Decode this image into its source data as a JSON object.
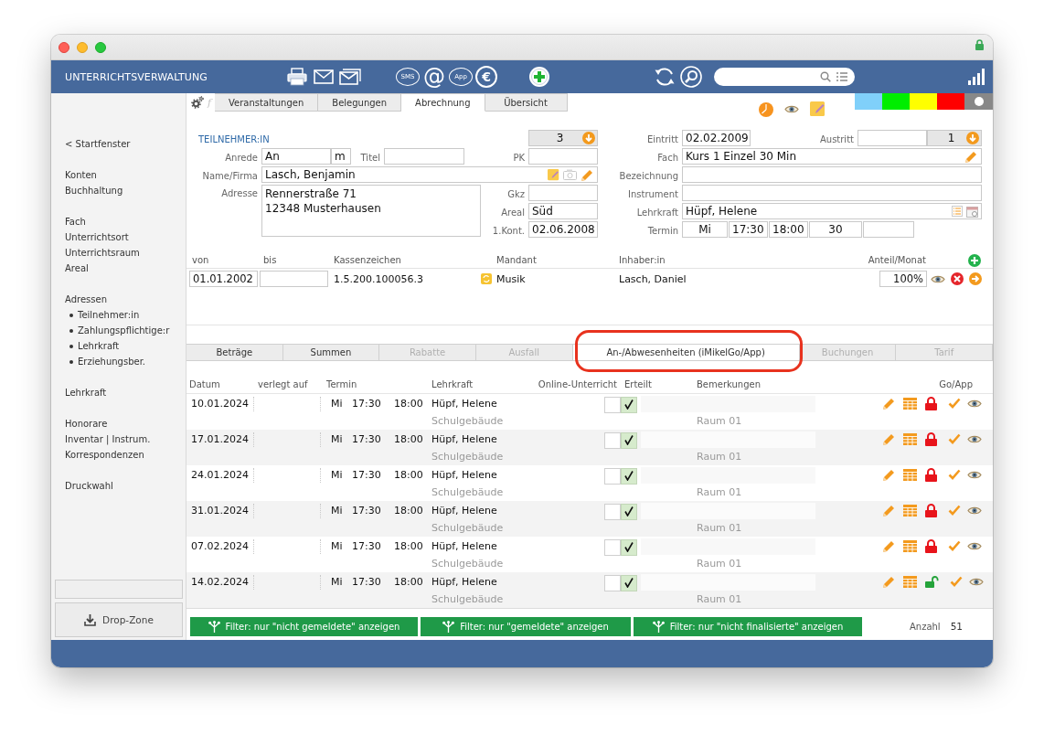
{
  "toolbar": {
    "title": "UNTERRICHTSVERWALTUNG",
    "button_groups": [
      [
        {
          "kind": "printer"
        },
        {
          "kind": "mail"
        },
        {
          "kind": "mail-stack"
        }
      ],
      [
        {
          "kind": "bubble",
          "text": "SMS"
        },
        {
          "kind": "glyph",
          "text": "@"
        },
        {
          "kind": "bubble",
          "text": "App"
        },
        {
          "kind": "ring",
          "text": "€"
        }
      ],
      [
        {
          "kind": "add"
        }
      ],
      [
        {
          "kind": "refresh"
        },
        {
          "kind": "search"
        }
      ]
    ]
  },
  "tab_tools": {
    "function_key": "f"
  },
  "tabs": [
    {
      "label": "Veranstaltungen",
      "selected": false
    },
    {
      "label": "Belegungen",
      "selected": false
    },
    {
      "label": "Abrechnung",
      "selected": true
    },
    {
      "label": "Übersicht",
      "selected": false
    }
  ],
  "color_swatches": [
    {
      "kind": "swatch",
      "color": "#80d0fa"
    },
    {
      "kind": "swatch",
      "color": "#00ee00"
    },
    {
      "kind": "swatch",
      "color": "#ffff00"
    },
    {
      "kind": "swatch",
      "color": "#ff0000"
    },
    {
      "kind": "dot",
      "color": "#888888"
    }
  ],
  "sidebar": {
    "groups": [
      [
        {
          "label": "< Startfenster"
        }
      ],
      [
        {
          "label": "Konten"
        },
        {
          "label": "Buchhaltung"
        }
      ],
      [
        {
          "label": "Fach"
        },
        {
          "label": "Unterrichtsort"
        },
        {
          "label": "Unterrichtsraum"
        },
        {
          "label": "Areal"
        }
      ],
      [
        {
          "label": "Adressen",
          "children": [
            {
              "label": "Teilnehmer:in"
            },
            {
              "label": "Zahlungspflichtige:r"
            },
            {
              "label": "Lehrkraft"
            },
            {
              "label": "Erziehungsber."
            }
          ]
        }
      ],
      [
        {
          "label": "Lehrkraft"
        }
      ],
      [
        {
          "label": "Honorare"
        },
        {
          "label": "Inventar | Instrum."
        },
        {
          "label": "Korrespondenzen"
        }
      ],
      [
        {
          "label": "Druckwahl"
        }
      ]
    ],
    "drop_zone": "Drop-Zone"
  },
  "participant": {
    "heading": "TEILNEHMER:IN",
    "counter": "3",
    "salutation": {
      "label": "Anrede",
      "value": "An",
      "gender": "m"
    },
    "title": {
      "label": "Titel"
    },
    "pk": {
      "label": "PK"
    },
    "name": {
      "label": "Name/Firma",
      "value": "Lasch, Benjamin"
    },
    "address": {
      "label": "Adresse",
      "lines": [
        "Rennerstraße 71",
        "12348 Musterhausen"
      ]
    },
    "gkz": {
      "label": "Gkz"
    },
    "area": {
      "label": "Areal",
      "value": "Süd"
    },
    "first_contact": {
      "label": "1.Kont.",
      "value": "02.06.2008"
    }
  },
  "course": {
    "entry": {
      "label": "Eintritt",
      "value": "02.02.2009"
    },
    "exit": {
      "label": "Austritt",
      "counter": "1"
    },
    "subject": {
      "label": "Fach",
      "value": "Kurs 1 Einzel 30 Min"
    },
    "designation": {
      "label": "Bezeichnung"
    },
    "instrument": {
      "label": "Instrument"
    },
    "teacher": {
      "label": "Lehrkraft",
      "value": "Hüpf, Helene"
    },
    "schedule": {
      "label": "Termin",
      "day": "Mi",
      "start": "17:30",
      "end": "18:00",
      "minutes": "30"
    }
  },
  "payers": {
    "columns": [
      "von",
      "bis",
      "Kassenzeichen",
      "Mandant",
      "Inhaber:in",
      "Anteil/Monat"
    ],
    "rows": [
      {
        "from": "01.01.2002",
        "reference": "1.5.200.100056.3",
        "client": "Musik",
        "holder": "Lasch, Daniel",
        "share": "100%"
      }
    ]
  },
  "detail_tabs": [
    {
      "label": "Beträge",
      "selected": false,
      "disabled": false,
      "highlighted": false
    },
    {
      "label": "Summen",
      "selected": false,
      "disabled": false,
      "highlighted": false
    },
    {
      "label": "Rabatte",
      "selected": false,
      "disabled": true,
      "highlighted": false
    },
    {
      "label": "Ausfall",
      "selected": false,
      "disabled": true,
      "highlighted": false
    },
    {
      "label": "An-/Abwesenheiten (iMikelGo/App)",
      "selected": true,
      "disabled": false,
      "highlighted": true
    },
    {
      "label": "Buchungen",
      "selected": false,
      "disabled": true,
      "highlighted": false
    },
    {
      "label": "Tarif",
      "selected": false,
      "disabled": true,
      "highlighted": false
    }
  ],
  "attendance": {
    "columns": [
      "Datum",
      "verlegt auf",
      "Termin",
      "Lehrkraft",
      "Online-Unterricht",
      "Erteilt",
      "Bemerkungen",
      "Go/App"
    ],
    "rows": [
      {
        "date": "10.01.2024",
        "day": "Mi",
        "start": "17:30",
        "end": "18:00",
        "teacher": "Hüpf, Helene",
        "location": "Schulgebäude",
        "room": "Raum 01",
        "online": false,
        "given": true,
        "locked": true
      },
      {
        "date": "17.01.2024",
        "day": "Mi",
        "start": "17:30",
        "end": "18:00",
        "teacher": "Hüpf, Helene",
        "location": "Schulgebäude",
        "room": "Raum 01",
        "online": false,
        "given": true,
        "locked": true
      },
      {
        "date": "24.01.2024",
        "day": "Mi",
        "start": "17:30",
        "end": "18:00",
        "teacher": "Hüpf, Helene",
        "location": "Schulgebäude",
        "room": "Raum 01",
        "online": false,
        "given": true,
        "locked": true
      },
      {
        "date": "31.01.2024",
        "day": "Mi",
        "start": "17:30",
        "end": "18:00",
        "teacher": "Hüpf, Helene",
        "location": "Schulgebäude",
        "room": "Raum 01",
        "online": false,
        "given": true,
        "locked": true
      },
      {
        "date": "07.02.2024",
        "day": "Mi",
        "start": "17:30",
        "end": "18:00",
        "teacher": "Hüpf, Helene",
        "location": "Schulgebäude",
        "room": "Raum 01",
        "online": false,
        "given": true,
        "locked": true
      },
      {
        "date": "14.02.2024",
        "day": "Mi",
        "start": "17:30",
        "end": "18:00",
        "teacher": "Hüpf, Helene",
        "location": "Schulgebäude",
        "room": "Raum 01",
        "online": false,
        "given": true,
        "locked": false
      }
    ],
    "filters": [
      "Filter: nur \"nicht gemeldete\" anzeigen",
      "Filter: nur \"gemeldete\" anzeigen",
      "Filter: nur \"nicht finalisierte\" anzeigen"
    ],
    "count_label": "Anzahl",
    "count": "51"
  }
}
